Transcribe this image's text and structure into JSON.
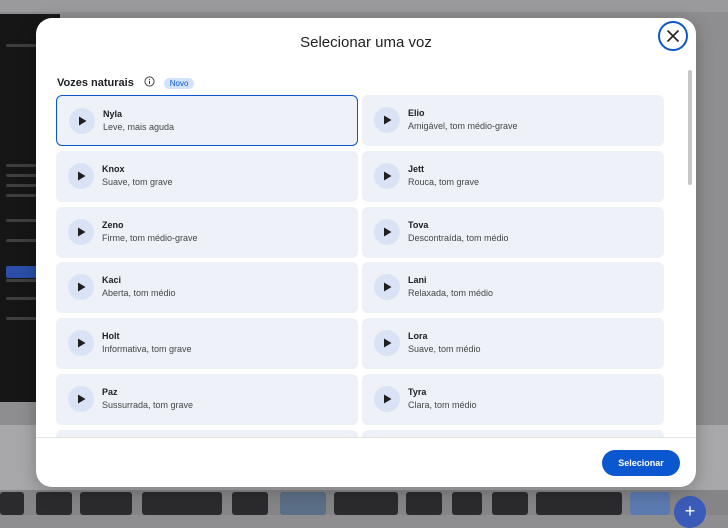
{
  "modal": {
    "title": "Selecionar uma voz",
    "section_title": "Vozes naturais",
    "badge": "Novo",
    "select_label": "Selecionar"
  },
  "voices": [
    {
      "name": "Nyla",
      "desc": "Leve, mais aguda",
      "selected": true
    },
    {
      "name": "Elio",
      "desc": "Amigável, tom médio-grave"
    },
    {
      "name": "Knox",
      "desc": "Suave, tom grave"
    },
    {
      "name": "Jett",
      "desc": "Rouca, tom grave"
    },
    {
      "name": "Zeno",
      "desc": "Firme, tom médio-grave"
    },
    {
      "name": "Tova",
      "desc": "Descontraída, tom médio"
    },
    {
      "name": "Kaci",
      "desc": "Aberta, tom médio"
    },
    {
      "name": "Lani",
      "desc": "Relaxada, tom médio"
    },
    {
      "name": "Holt",
      "desc": "Informativa, tom grave"
    },
    {
      "name": "Lora",
      "desc": "Suave, tom médio"
    },
    {
      "name": "Paz",
      "desc": "Sussurrada, tom grave"
    },
    {
      "name": "Tyra",
      "desc": "Clara, tom médio"
    }
  ],
  "colors": {
    "accent": "#0b57d0",
    "card_bg": "#eef1f7",
    "badge_bg": "#d3e3fd"
  },
  "icons": {
    "close": "close-icon",
    "info": "info-icon",
    "play": "play-icon"
  }
}
